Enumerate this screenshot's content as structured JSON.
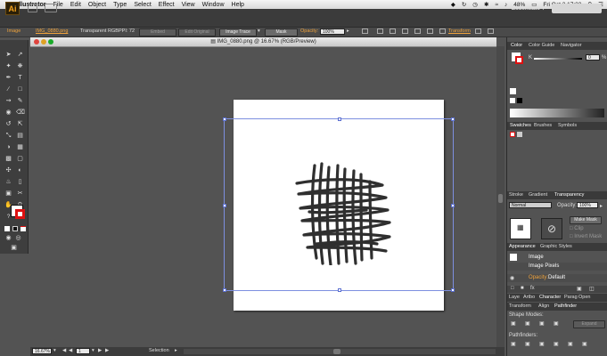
{
  "menubar": {
    "app_name": "Illustrator",
    "items": [
      "File",
      "Edit",
      "Object",
      "Type",
      "Select",
      "Effect",
      "View",
      "Window",
      "Help"
    ],
    "battery": "48%",
    "clock": "Fri Oct 3  17:33"
  },
  "appbar": {
    "logo": "Ai",
    "workspace": "Essentials"
  },
  "control": {
    "object_type": "Image",
    "filename": "IMG_0880.png",
    "color_mode": "Transparent RGB",
    "ppi": "PPI: 72",
    "embed": "Embed",
    "edit_original": "Edit Original",
    "image_trace": "Image Trace",
    "mask": "Mask",
    "opacity_label": "Opacity:",
    "opacity_value": "100%",
    "transform": "Transform"
  },
  "document": {
    "title": "IMG_0880.png @ 16.67% (RGB/Preview)",
    "zoom": "16.67%",
    "page": "1",
    "status": "Selection"
  },
  "panels": {
    "color_tabs": [
      "Color",
      "Color Guide",
      "Navigator"
    ],
    "color_channel": "K",
    "color_value": "0",
    "swatch_tabs": [
      "Swatches",
      "Brushes",
      "Symbols"
    ],
    "stroke_tabs": [
      "Stroke",
      "Gradient",
      "Transparency"
    ],
    "blend_mode": "Normal",
    "opacity_label": "Opacity:",
    "opacity_value": "100%",
    "make_mask": "Make Mask",
    "clip": "Clip",
    "invert_mask": "Invert Mask",
    "appearance_tabs": [
      "Appearance",
      "Graphic Styles"
    ],
    "appearance_title": "Image",
    "appearance_row": "Image Pixels",
    "appearance_opacity_label": "Opacity:",
    "appearance_opacity_value": "Default",
    "bottom_tabs": [
      "Laye",
      "Artbo",
      "Character",
      "Parag",
      "Open"
    ],
    "bottom_tabs2": [
      "Transform",
      "Align",
      "Pathfinder"
    ],
    "shape_modes": "Shape Modes:",
    "expand": "Expand",
    "pathfinders": "Pathfinders:"
  }
}
